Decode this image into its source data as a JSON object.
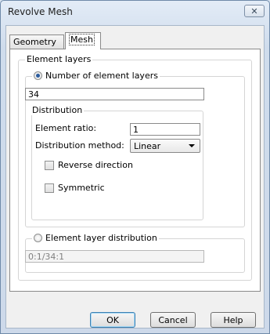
{
  "window": {
    "title": "Revolve Mesh",
    "close_icon": "close-icon"
  },
  "tabs": [
    {
      "label": "Geometry",
      "selected": false
    },
    {
      "label": "Mesh",
      "selected": true
    }
  ],
  "element_layers": {
    "group_label": "Element layers",
    "number_option": {
      "label": "Number of element layers",
      "selected": true,
      "value": "34"
    },
    "distribution": {
      "group_label": "Distribution",
      "ratio_label": "Element ratio:",
      "ratio_value": "1",
      "method_label": "Distribution method:",
      "method_value": "Linear",
      "reverse_label": "Reverse direction",
      "reverse_checked": false,
      "symmetric_label": "Symmetric",
      "symmetric_checked": false
    },
    "layer_distribution_option": {
      "label": "Element layer distribution",
      "selected": false,
      "value": "0:1/34:1"
    }
  },
  "buttons": {
    "ok": "OK",
    "cancel": "Cancel",
    "help": "Help"
  }
}
